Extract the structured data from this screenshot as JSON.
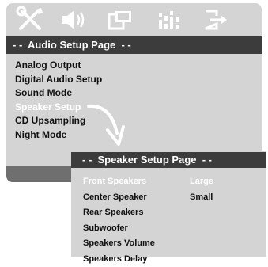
{
  "main": {
    "title": "- -  Audio Setup Page  - -",
    "items": [
      {
        "label": "Analog Output"
      },
      {
        "label": "Digital Audio Setup"
      },
      {
        "label": "Sound Mode"
      },
      {
        "label": "Speaker Setup",
        "selected": true
      },
      {
        "label": "CD Upsampling"
      },
      {
        "label": "Night Mode"
      }
    ]
  },
  "toolbar": {
    "icons": [
      "tools-icon",
      "speaker-icon",
      "display-icon",
      "equalizer-icon",
      "exit-icon"
    ]
  },
  "submenu": {
    "title": "- -  Speaker Setup Page  - -",
    "items": [
      {
        "label": "Front Speakers",
        "value": "Large",
        "selected": true
      },
      {
        "label": "Center Speaker",
        "value": "Small"
      },
      {
        "label": "Rear Speakers",
        "value": ""
      },
      {
        "label": "Subwoofer",
        "value": ""
      },
      {
        "label": "Speakers Volume",
        "value": ""
      },
      {
        "label": "Speakers Delay",
        "value": ""
      }
    ]
  },
  "colors": {
    "panel": "#d4d4d4",
    "title_bar": "#3c3c3c",
    "strip": "#6f6f6f",
    "highlight_text": "#ffffff"
  }
}
